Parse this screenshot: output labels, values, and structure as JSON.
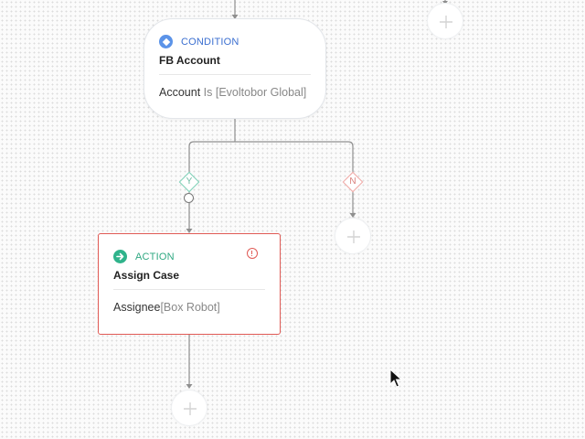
{
  "condition_node": {
    "type_label": "CONDITION",
    "title": "FB Account",
    "rule_key": "Account",
    "rule_operator": "Is",
    "rule_value": "[Evoltobor Global]",
    "icon": "diamond-icon",
    "accent_color": "#5b93e8"
  },
  "branches": {
    "yes_label": "Y",
    "no_label": "N",
    "yes_color": "#7fd1b8",
    "no_color": "#f0a9a6"
  },
  "action_node": {
    "type_label": "ACTION",
    "title": "Assign Case",
    "rule_key": "Assignee",
    "rule_value": "[Box Robot]",
    "icon": "arrow-circle-icon",
    "status_icon": "warning-icon",
    "accent_color": "#2fb38b",
    "error_color": "#e05a55"
  },
  "add_buttons": {
    "icon": "plus-icon"
  }
}
